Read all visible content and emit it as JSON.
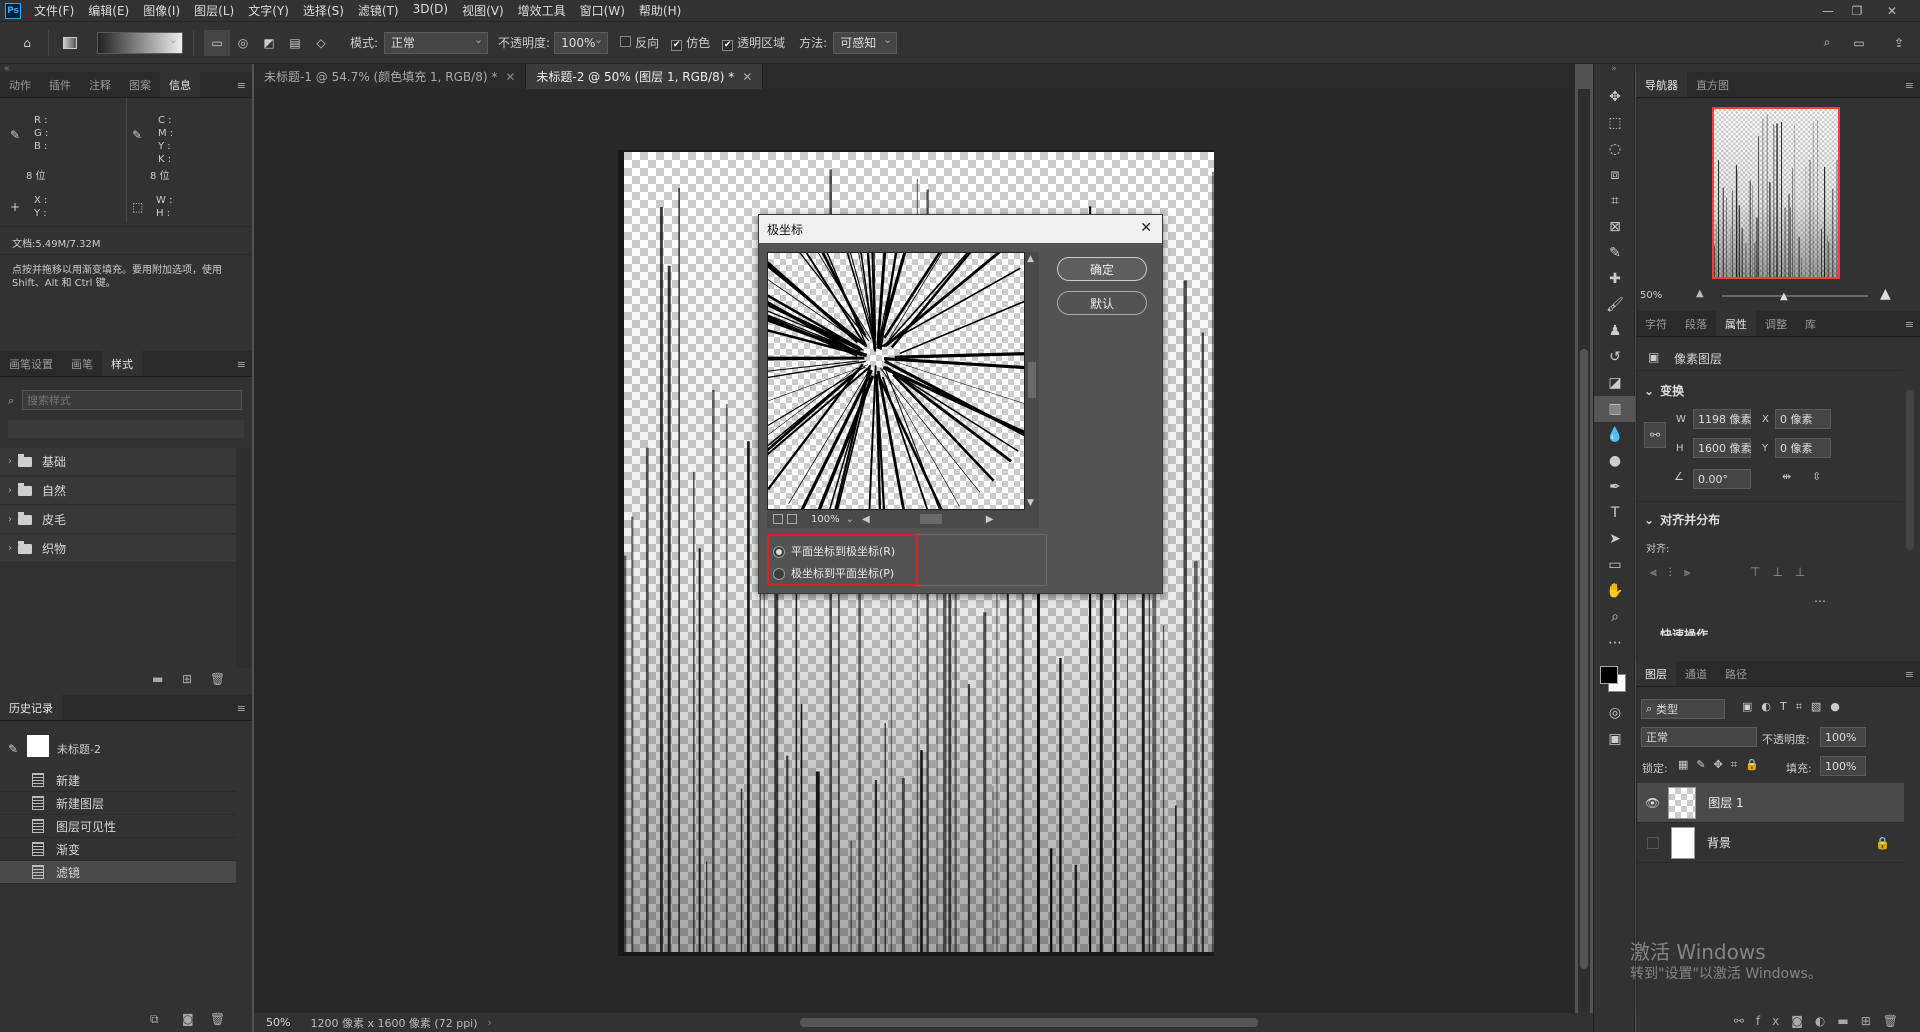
{
  "menubar": {
    "logo": "Ps",
    "items": [
      "文件(F)",
      "编辑(E)",
      "图像(I)",
      "图层(L)",
      "文字(Y)",
      "选择(S)",
      "滤镜(T)",
      "3D(D)",
      "视图(V)",
      "增效工具",
      "窗口(W)",
      "帮助(H)"
    ]
  },
  "options": {
    "mode_label": "模式:",
    "mode_value": "正常",
    "opacity_label": "不透明度:",
    "opacity_value": "100%",
    "reverse_label": "反向",
    "dither_label": "仿色",
    "transparency_label": "透明区域",
    "method_label": "方法:",
    "method_value": "可感知"
  },
  "left_top_tabs": [
    "动作",
    "插件",
    "注释",
    "图案",
    "信息"
  ],
  "info": {
    "r": "R :",
    "g": "G :",
    "b": "B :",
    "bits1": "8 位",
    "c": "C :",
    "m": "M :",
    "y": "Y :",
    "k": "K :",
    "bits2": "8 位",
    "x": "X :",
    "yy": "Y :",
    "w": "W :",
    "h": "H :",
    "doc": "文档:5.49M/7.32M",
    "hint": "点按并拖移以用渐变填充。要用附加选项，使用 Shift、Alt 和 Ctrl 键。"
  },
  "style_tabs": [
    "画笔设置",
    "画笔",
    "样式"
  ],
  "styles": {
    "search_placeholder": "搜索样式",
    "folders": [
      "基础",
      "自然",
      "皮毛",
      "织物"
    ]
  },
  "history": {
    "title": "历史记录",
    "snapshot": "未标题-2",
    "items": [
      "新建",
      "新建图层",
      "图层可见性",
      "渐变",
      "滤镜"
    ]
  },
  "doc_tabs": [
    "未标题-1 @ 54.7% (颜色填充 1, RGB/8) *",
    "未标题-2 @ 50% (图层 1, RGB/8) *"
  ],
  "status": {
    "zoom": "50%",
    "size": "1200 像素 x 1600 像素 (72 ppi)"
  },
  "dialog": {
    "title": "极坐标",
    "ok": "确定",
    "default": "默认",
    "zoom": "100%",
    "option1": "平面坐标到极坐标(R)",
    "option2": "极坐标到平面坐标(P)",
    "highlight_color": "#e02020"
  },
  "navigator": {
    "tabs": [
      "导航器",
      "直方图"
    ],
    "zoom": "50%"
  },
  "props": {
    "tabs": [
      "字符",
      "段落",
      "属性",
      "调整",
      "库"
    ],
    "layer_type": "像素图层",
    "transform": "变换",
    "w_label": "W",
    "w": "1198 像素",
    "x_label": "X",
    "x": "0 像素",
    "h_label": "H",
    "h": "1600 像素",
    "y_label": "Y",
    "y": "0 像素",
    "angle": "0.00°",
    "align_title": "对齐并分布",
    "align_label": "对齐:",
    "more_title": "快速操作"
  },
  "layers": {
    "tabs": [
      "图层",
      "通道",
      "路径"
    ],
    "filter": "类型",
    "blend": "正常",
    "opacity_label": "不透明度:",
    "opacity": "100%",
    "lock_label": "锁定:",
    "fill_label": "填充:",
    "fill": "100%",
    "rows": [
      "图层 1",
      "背景"
    ]
  },
  "watermark": {
    "line1": "激活 Windows",
    "line2": "转到\"设置\"以激活 Windows。"
  }
}
